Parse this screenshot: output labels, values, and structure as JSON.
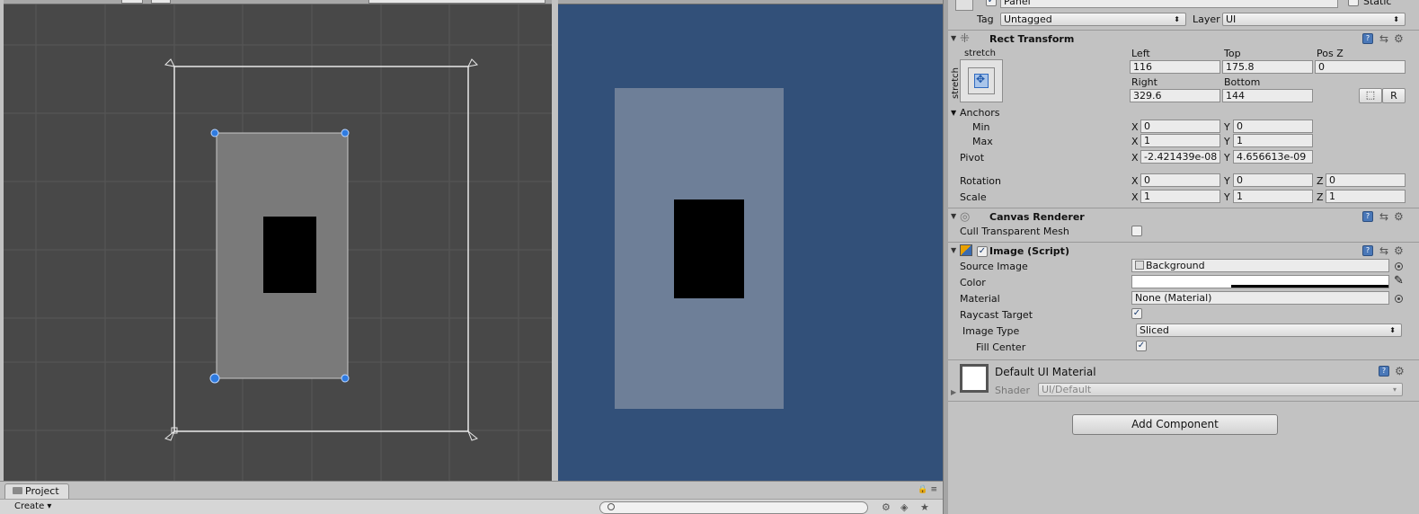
{
  "scene_view": {
    "colors": {
      "background": "#484848",
      "grid": "#575757",
      "canvas_outline": "#e8e8e8",
      "panel": "#7a7a7a",
      "image": "#000000",
      "handle": "#2f7be0"
    }
  },
  "game_view": {
    "colors": {
      "background": "#325079",
      "panel": "#6e7f98",
      "image": "#000000"
    }
  },
  "project": {
    "tab_label": "Project",
    "create_label": "Create ▾"
  },
  "inspector": {
    "object": {
      "name": "Panel",
      "static_label": "Static",
      "tag_label": "Tag",
      "tag_value": "Untagged",
      "layer_label": "Layer",
      "layer_value": "UI"
    },
    "rect_transform": {
      "title": "Rect Transform",
      "preset_top_label": "stretch",
      "preset_side_label": "stretch",
      "left_label": "Left",
      "left_value": "116",
      "top_label": "Top",
      "top_value": "175.8",
      "posz_label": "Pos Z",
      "posz_value": "0",
      "right_label": "Right",
      "right_value": "329.6",
      "bottom_label": "Bottom",
      "bottom_value": "144",
      "r_button": "R",
      "anchors_label": "Anchors",
      "min_label": "Min",
      "min_x": "0",
      "min_y": "0",
      "max_label": "Max",
      "max_x": "1",
      "max_y": "1",
      "pivot_label": "Pivot",
      "pivot_x": "-2.421439e-08",
      "pivot_y": "4.656613e-09",
      "rotation_label": "Rotation",
      "rot_x": "0",
      "rot_y": "0",
      "rot_z": "0",
      "scale_label": "Scale",
      "scale_x": "1",
      "scale_y": "1",
      "scale_z": "1",
      "axis_x": "X",
      "axis_y": "Y",
      "axis_z": "Z"
    },
    "canvas_renderer": {
      "title": "Canvas Renderer",
      "cull_label": "Cull Transparent Mesh"
    },
    "image": {
      "title": "Image (Script)",
      "source_label": "Source Image",
      "source_value": "Background",
      "color_label": "Color",
      "material_label": "Material",
      "material_value": "None (Material)",
      "raycast_label": "Raycast Target",
      "image_type_label": "Image Type",
      "image_type_value": "Sliced",
      "fill_center_label": "Fill Center"
    },
    "material": {
      "name": "Default UI Material",
      "shader_label": "Shader",
      "shader_value": "UI/Default"
    },
    "add_component_label": "Add Component"
  }
}
